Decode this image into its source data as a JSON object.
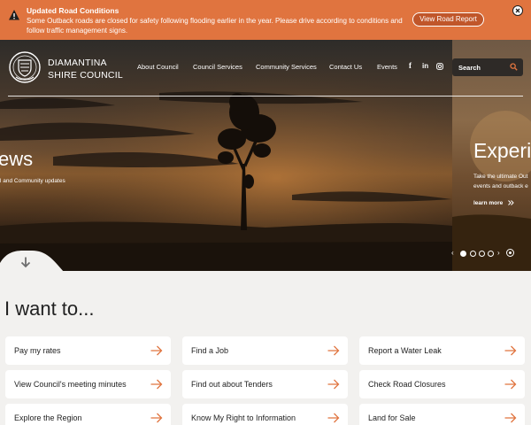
{
  "alert": {
    "title": "Updated Road Conditions",
    "text": "Some Outback roads are closed for safety following flooding earlier in the year. Please drive according to conditions and follow traffic management signs.",
    "button": "View Road Report",
    "icon": "warning-icon",
    "color": "#e0743f"
  },
  "brand": {
    "line1": "DIAMANTINA",
    "line2": "SHIRE COUNCIL"
  },
  "nav": {
    "items": [
      "About Council",
      "Council Services",
      "Community Services",
      "Contact Us",
      "Events"
    ],
    "social": [
      "f",
      "in",
      "instagram-icon"
    ],
    "search_placeholder": "Search"
  },
  "slides": [
    {
      "title": "ews",
      "subtitle": "l and Community updates"
    },
    {
      "title": "Experien",
      "subtitle_line1": "Take the ultimate Out",
      "subtitle_line2": "events and outback e",
      "link": "learn more"
    }
  ],
  "carousel": {
    "count": 5,
    "active": 1
  },
  "i_want_to": {
    "title": "I want to...",
    "tiles": [
      [
        "Pay my rates",
        "Find a Job",
        "Report a Water Leak"
      ],
      [
        "View Council's meeting minutes",
        "Find out about Tenders",
        "Check Road Closures"
      ],
      [
        "Explore the Region",
        "Know My Right to Information",
        "Land for Sale"
      ]
    ]
  },
  "colors": {
    "accent": "#e0743f",
    "background": "#f2f1ef"
  }
}
